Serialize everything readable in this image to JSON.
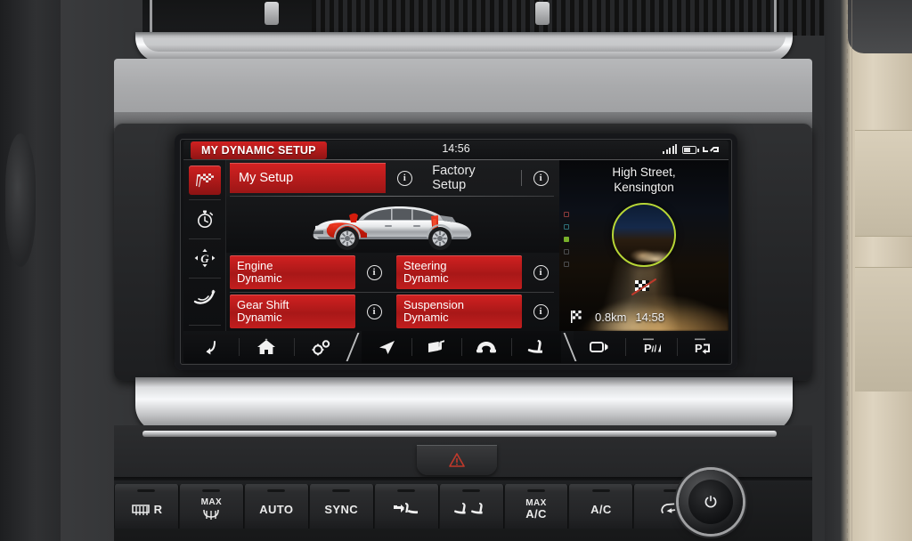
{
  "screen": {
    "status_bar": {
      "title": "MY DYNAMIC SETUP",
      "clock": "14:56",
      "icons": [
        "signal-bars-icon",
        "battery-icon",
        "media-icon"
      ]
    },
    "sidebar": {
      "items": [
        {
          "name": "dynamic-mode",
          "icon": "checkered-flags-icon",
          "active": true
        },
        {
          "name": "lap-timer",
          "icon": "stopwatch-icon",
          "active": false
        },
        {
          "name": "g-meter",
          "icon": "g-force-icon",
          "active": false
        },
        {
          "name": "cornering",
          "icon": "curve-icon",
          "active": false
        }
      ]
    },
    "tabs": [
      {
        "label": "My Setup",
        "selected": true,
        "info_icon": "info-icon"
      },
      {
        "label": "Factory Setup",
        "selected": false,
        "info_icon": "info-icon"
      }
    ],
    "vehicle_image_alt": "vehicle-side-profile",
    "settings": [
      {
        "name": "Engine",
        "value": "Dynamic",
        "info_icon": "info-icon"
      },
      {
        "name": "Steering",
        "value": "Dynamic",
        "info_icon": "info-icon"
      },
      {
        "name": "Gear Shift",
        "value": "Dynamic",
        "info_icon": "info-icon"
      },
      {
        "name": "Suspension",
        "value": "Dynamic",
        "info_icon": "info-icon"
      }
    ],
    "navigation": {
      "destination_line1": "High Street,",
      "destination_line2": "Kensington",
      "distance": "0.8km",
      "eta": "14:58",
      "flag_icon": "checkered-flag-icon",
      "preview_alt": "road-night-preview"
    },
    "toolbar": [
      {
        "name": "back",
        "icon": "back-arrow-icon"
      },
      {
        "name": "home",
        "icon": "home-icon"
      },
      {
        "name": "settings",
        "icon": "gears-icon"
      },
      {
        "name": "navigation",
        "icon": "nav-arrow-icon"
      },
      {
        "name": "media",
        "icon": "media-icon"
      },
      {
        "name": "phone",
        "icon": "phone-icon"
      },
      {
        "name": "seat-comfort",
        "icon": "seat-icon"
      },
      {
        "name": "camera",
        "icon": "camera-icon"
      },
      {
        "name": "park-distance",
        "icon": "park-distance-icon"
      },
      {
        "name": "park-assist",
        "icon": "park-assist-icon"
      }
    ]
  },
  "colors": {
    "accent_red": "#d42222",
    "accent_red_dark": "#9c1616",
    "nav_ring_green": "#b7d636",
    "screen_bg": "#0c0c0e",
    "text": "#f2f2f2"
  },
  "console": {
    "hazard_button": {
      "name": "hazard-button",
      "icon": "hazard-triangle-icon"
    },
    "power_knob": {
      "name": "power-knob",
      "icon": "power-icon"
    },
    "climate_buttons": [
      {
        "name": "rear-defrost",
        "label": "R",
        "icon": "rear-defrost-icon",
        "style": "icon-label"
      },
      {
        "name": "max-defrost",
        "label": "MAX",
        "icon": "windscreen-defrost-icon",
        "style": "stacked-icon"
      },
      {
        "name": "auto",
        "label": "AUTO",
        "style": "text"
      },
      {
        "name": "sync",
        "label": "SYNC",
        "style": "text"
      },
      {
        "name": "airflow-direction",
        "label": "",
        "icon": "airflow-icon",
        "style": "icon"
      },
      {
        "name": "seat-heaters",
        "label": "",
        "icon": "dual-seat-icon",
        "style": "icon"
      },
      {
        "name": "max-ac",
        "label": "MAX A/C",
        "style": "stacked-text"
      },
      {
        "name": "ac",
        "label": "A/C",
        "style": "text"
      },
      {
        "name": "recirculation",
        "label": "",
        "icon": "recirculation-icon",
        "style": "icon"
      }
    ]
  }
}
